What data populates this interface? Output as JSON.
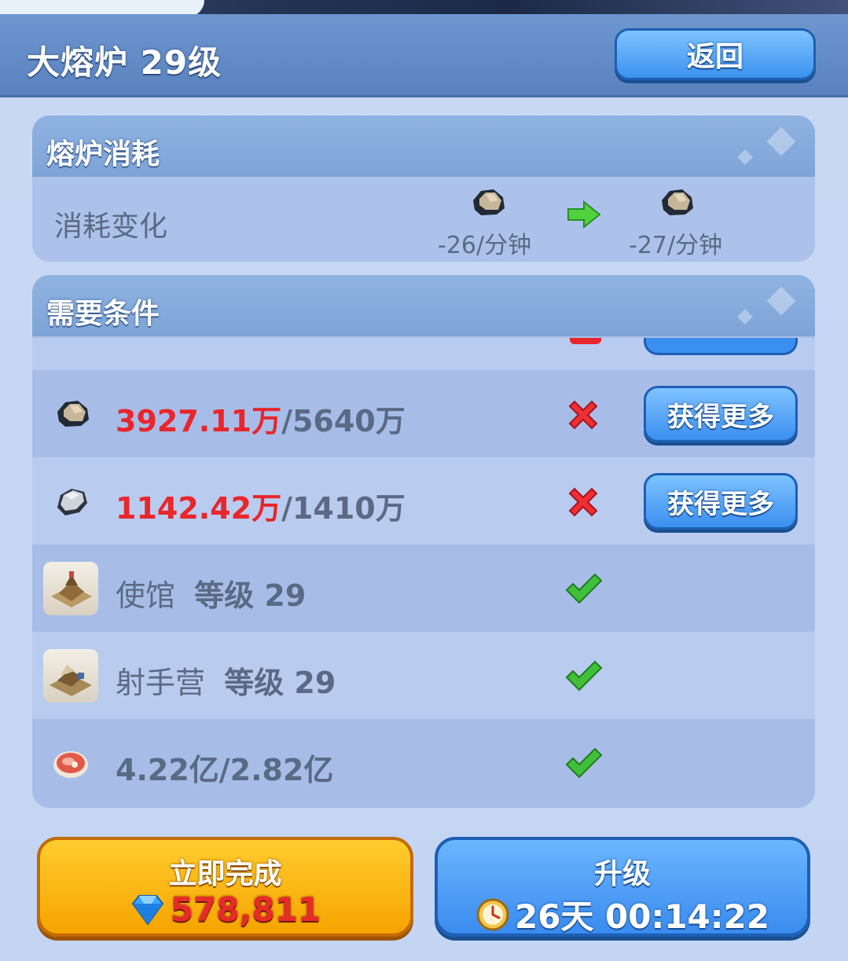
{
  "header": {
    "title": "大熔炉  29级",
    "back_label": "返回"
  },
  "consume": {
    "title": "熔炉消耗",
    "label": "消耗变化",
    "from_rate": "-26/分钟",
    "to_rate": "-27/分钟"
  },
  "requirements": {
    "title": "需要条件",
    "rows": [
      {
        "icon": "coal-icon",
        "current": "3927.11万",
        "required": "/5640万",
        "status": "unmet",
        "button": "获得更多"
      },
      {
        "icon": "stone-icon",
        "current": "1142.42万",
        "required": "/1410万",
        "status": "unmet",
        "button": "获得更多"
      },
      {
        "icon": "embassy-building-icon",
        "name": "使馆",
        "level_label": "等级 29",
        "status": "met"
      },
      {
        "icon": "archer-camp-building-icon",
        "name": "射手营",
        "level_label": "等级 29",
        "status": "met"
      },
      {
        "icon": "meat-icon",
        "current": "4.22亿",
        "required": "/2.82亿",
        "status": "met"
      }
    ]
  },
  "footer": {
    "finish_label": "立即完成",
    "finish_cost": "578,811",
    "upgrade_label": "升级",
    "upgrade_time": "26天 00:14:22"
  },
  "colors": {
    "accent_blue": "#3b92ee",
    "gold": "#f6a400",
    "error_red": "#e8262b",
    "ok_green": "#3fbf3a"
  }
}
